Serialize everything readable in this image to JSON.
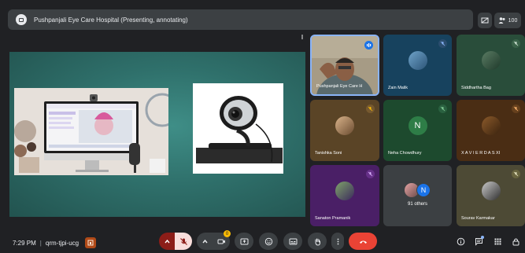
{
  "header": {
    "title": "Pushpanjali Eye Care Hospital (Presenting, annotating)",
    "participant_count": "100"
  },
  "participants": [
    {
      "name": "Pushpanjali Eye Care H",
      "muted": false,
      "speaking": true
    },
    {
      "name": "Zain Malik",
      "muted": true
    },
    {
      "name": "Siddhartha Bag",
      "muted": true
    },
    {
      "name": "Tanishka Soni",
      "muted": true
    },
    {
      "name": "Neha Chowdhury",
      "initial": "N",
      "muted": true
    },
    {
      "name": "X A V I E R D A S XI",
      "muted": true
    },
    {
      "name": "Sanaton Pramanik",
      "muted": true
    },
    {
      "name": "Sourav Karmakar",
      "muted": true
    }
  ],
  "others": {
    "label": "91 others",
    "initial": "N"
  },
  "footer": {
    "time": "7:29 PM",
    "meeting_code": "qrm-tjpi-ucg",
    "hands_badge": "0"
  },
  "colors": {
    "background": "#202124",
    "surface": "#3c4043",
    "danger": "#ea4335",
    "muted_badge": "#8430ce"
  }
}
